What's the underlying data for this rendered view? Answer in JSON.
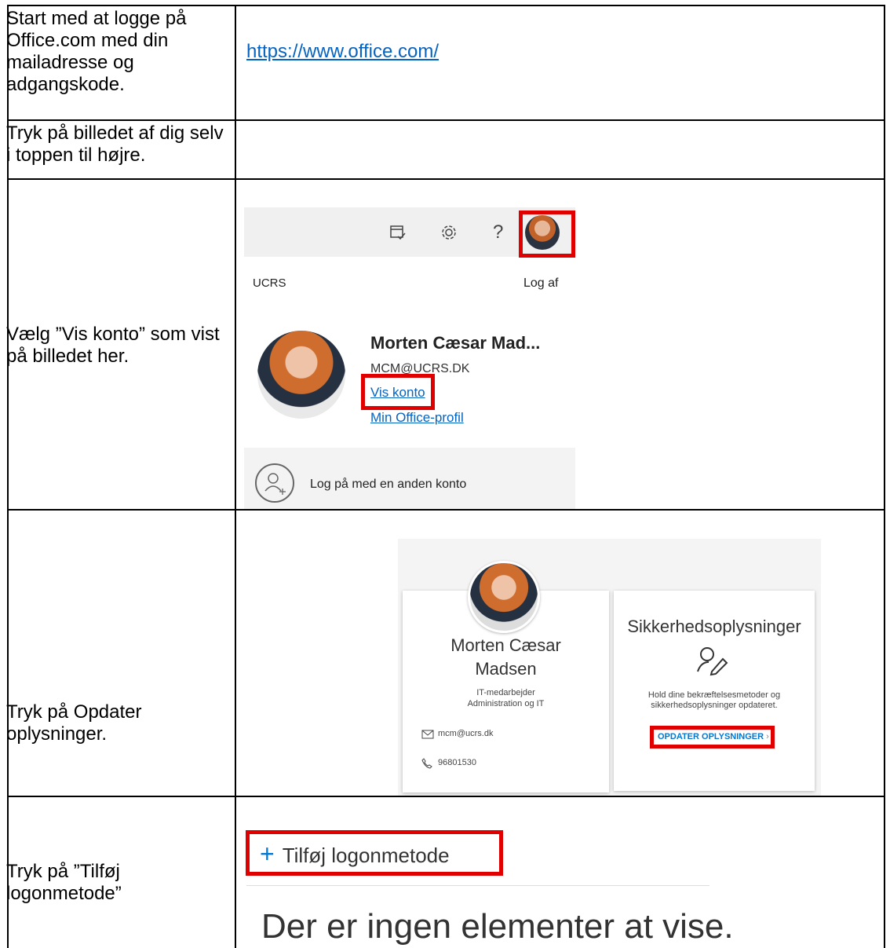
{
  "rows": [
    {
      "instruction": "Start med at logge på Office.com med din mailadresse og adgangskode.",
      "link": "https://www.office.com/"
    },
    {
      "instruction": "Tryk på billedet af dig selv i toppen til højre."
    },
    {
      "instruction": "Vælg ”Vis konto” som vist på billedet her."
    },
    {
      "instruction": "Tryk på Opdater oplysninger."
    },
    {
      "instruction": "Tryk på ”Tilføj logonmetode”"
    }
  ],
  "shot1": {
    "help_glyph": "?",
    "org": "UCRS",
    "logout": "Log af",
    "name": "Morten Cæsar Mad...",
    "email": "MCM@UCRS.DK",
    "view_account": "Vis konto",
    "office_profile": "Min Office-profil",
    "other_account": "Log på med en anden konto"
  },
  "shot2": {
    "name_line1": "Morten Cæsar",
    "name_line2": "Madsen",
    "role_line1": "IT-medarbejder",
    "role_line2": "Administration og IT",
    "email": "mcm@ucrs.dk",
    "phone": "96801530",
    "security_title": "Sikkerhedsoplysninger",
    "security_desc_line1": "Hold dine bekræftelsesmetoder og",
    "security_desc_line2": "sikkerhedsoplysninger opdateret.",
    "update_button": "OPDATER OPLYSNINGER"
  },
  "shot3": {
    "add_method": "Tilføj logonmetode",
    "empty_message": "Der er ingen elementer at vise."
  },
  "colors": {
    "highlight": "#e00000",
    "link": "#0563c1",
    "accent": "#0078d4"
  }
}
